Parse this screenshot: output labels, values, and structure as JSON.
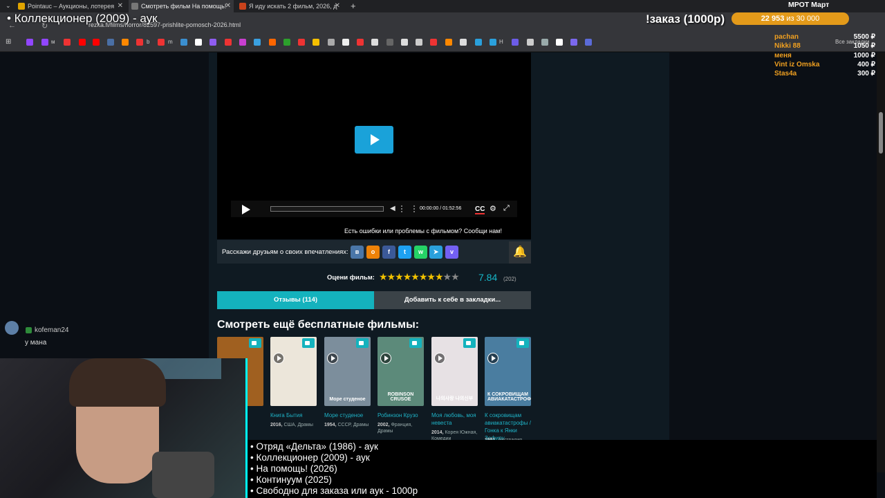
{
  "browser": {
    "tabs": [
      {
        "title": "Pointauc – Аукционы, лотерея",
        "color": "#e0a400"
      },
      {
        "title": "Смотреть фильм На помощь!",
        "color": "#777"
      },
      {
        "title": "Я иду искать 2 фильм, 2026, д",
        "color": "#c8421b"
      }
    ],
    "url": "rezka.fi/films/horror/82597-prishlite-pomosch-2026.html",
    "bookmark_labels": [
      "м",
      "b",
      "m",
      "Н"
    ],
    "all_bookmarks": "Все закладки"
  },
  "player": {
    "time": "00:00:00 / 01:52:56",
    "cc": "CC",
    "report": "Есть ошибки или проблемы с фильмом? Сообщи нам!"
  },
  "share": {
    "label": "Расскажи друзьям о своих впечатлениях:",
    "icons": [
      "vk-icon",
      "odnoklassniki-icon",
      "facebook-icon",
      "twitter-icon",
      "whatsapp-icon",
      "telegram-icon",
      "viber-icon"
    ]
  },
  "rating": {
    "label": "Оцени фильм:",
    "value": 7.84,
    "score_text": "7.84",
    "votes": "(202)",
    "stars_filled": 8,
    "stars_total": 10
  },
  "buttons": {
    "reviews": "Отзывы (114)",
    "bookmark": "Добавить к себе в закладки..."
  },
  "more": {
    "title": "Смотреть ещё бесплатные фильмы:",
    "films": [
      {
        "title": "",
        "year": "",
        "meta": "",
        "genre": "",
        "poster_text": "",
        "color": "#a06020"
      },
      {
        "title": "Книга Бытия",
        "year": "2016,",
        "meta": "США,",
        "genre": "Драмы",
        "poster_text": "",
        "color": "#ece6da"
      },
      {
        "title": "Море студеное",
        "year": "1954,",
        "meta": "СССР,",
        "genre": "Драмы",
        "poster_text": "Море студеное",
        "color": "#7c8e9c"
      },
      {
        "title": "Робинзон Крузо",
        "year": "2002,",
        "meta": "Франция,",
        "genre": "Драмы",
        "poster_text": "ROBINSON CRUSOE",
        "color": "#5c8a7a"
      },
      {
        "title": "Моя любовь, моя невеста",
        "year": "2014,",
        "meta": "Корея Южная,",
        "genre": "Комедии",
        "poster_text": "나의사랑 나의신부",
        "color": "#e7e1e4"
      },
      {
        "title": "К сокровищам авиакатастрофы / Гонка к Янки Зефиру",
        "year": "1981,",
        "meta": "Австралия,",
        "genre": "Боевики",
        "poster_text": "К СОКРОВИЩАМ АВИАКАТАСТРОФЫ",
        "color": "#4a7da0"
      }
    ]
  },
  "overlay": {
    "title": "• Коллекционер (2009) - аук",
    "order": "!заказ (1000р)",
    "goal_current": "22 953",
    "goal_total": "из 30 000",
    "mrot": "МРОТ Март",
    "donors": [
      {
        "name": "pachan",
        "amount": "5500 ₽"
      },
      {
        "name": "Nikki 88",
        "amount": "1050 ₽"
      },
      {
        "name": "меня",
        "amount": "1000 ₽"
      },
      {
        "name": "Vint iz Omska",
        "amount": "400 ₽"
      },
      {
        "name": "Stas4a",
        "amount": "300 ₽"
      }
    ],
    "chat": {
      "user": "kofeman24",
      "message": "у мана"
    },
    "list": [
      "• Отряд «Дельта» (1986) - аук",
      "• Коллекционер (2009) - аук",
      "• На помощь! (2026)",
      "• Континуум (2025)",
      "• Свободно для заказа или аук - 1000р"
    ]
  }
}
